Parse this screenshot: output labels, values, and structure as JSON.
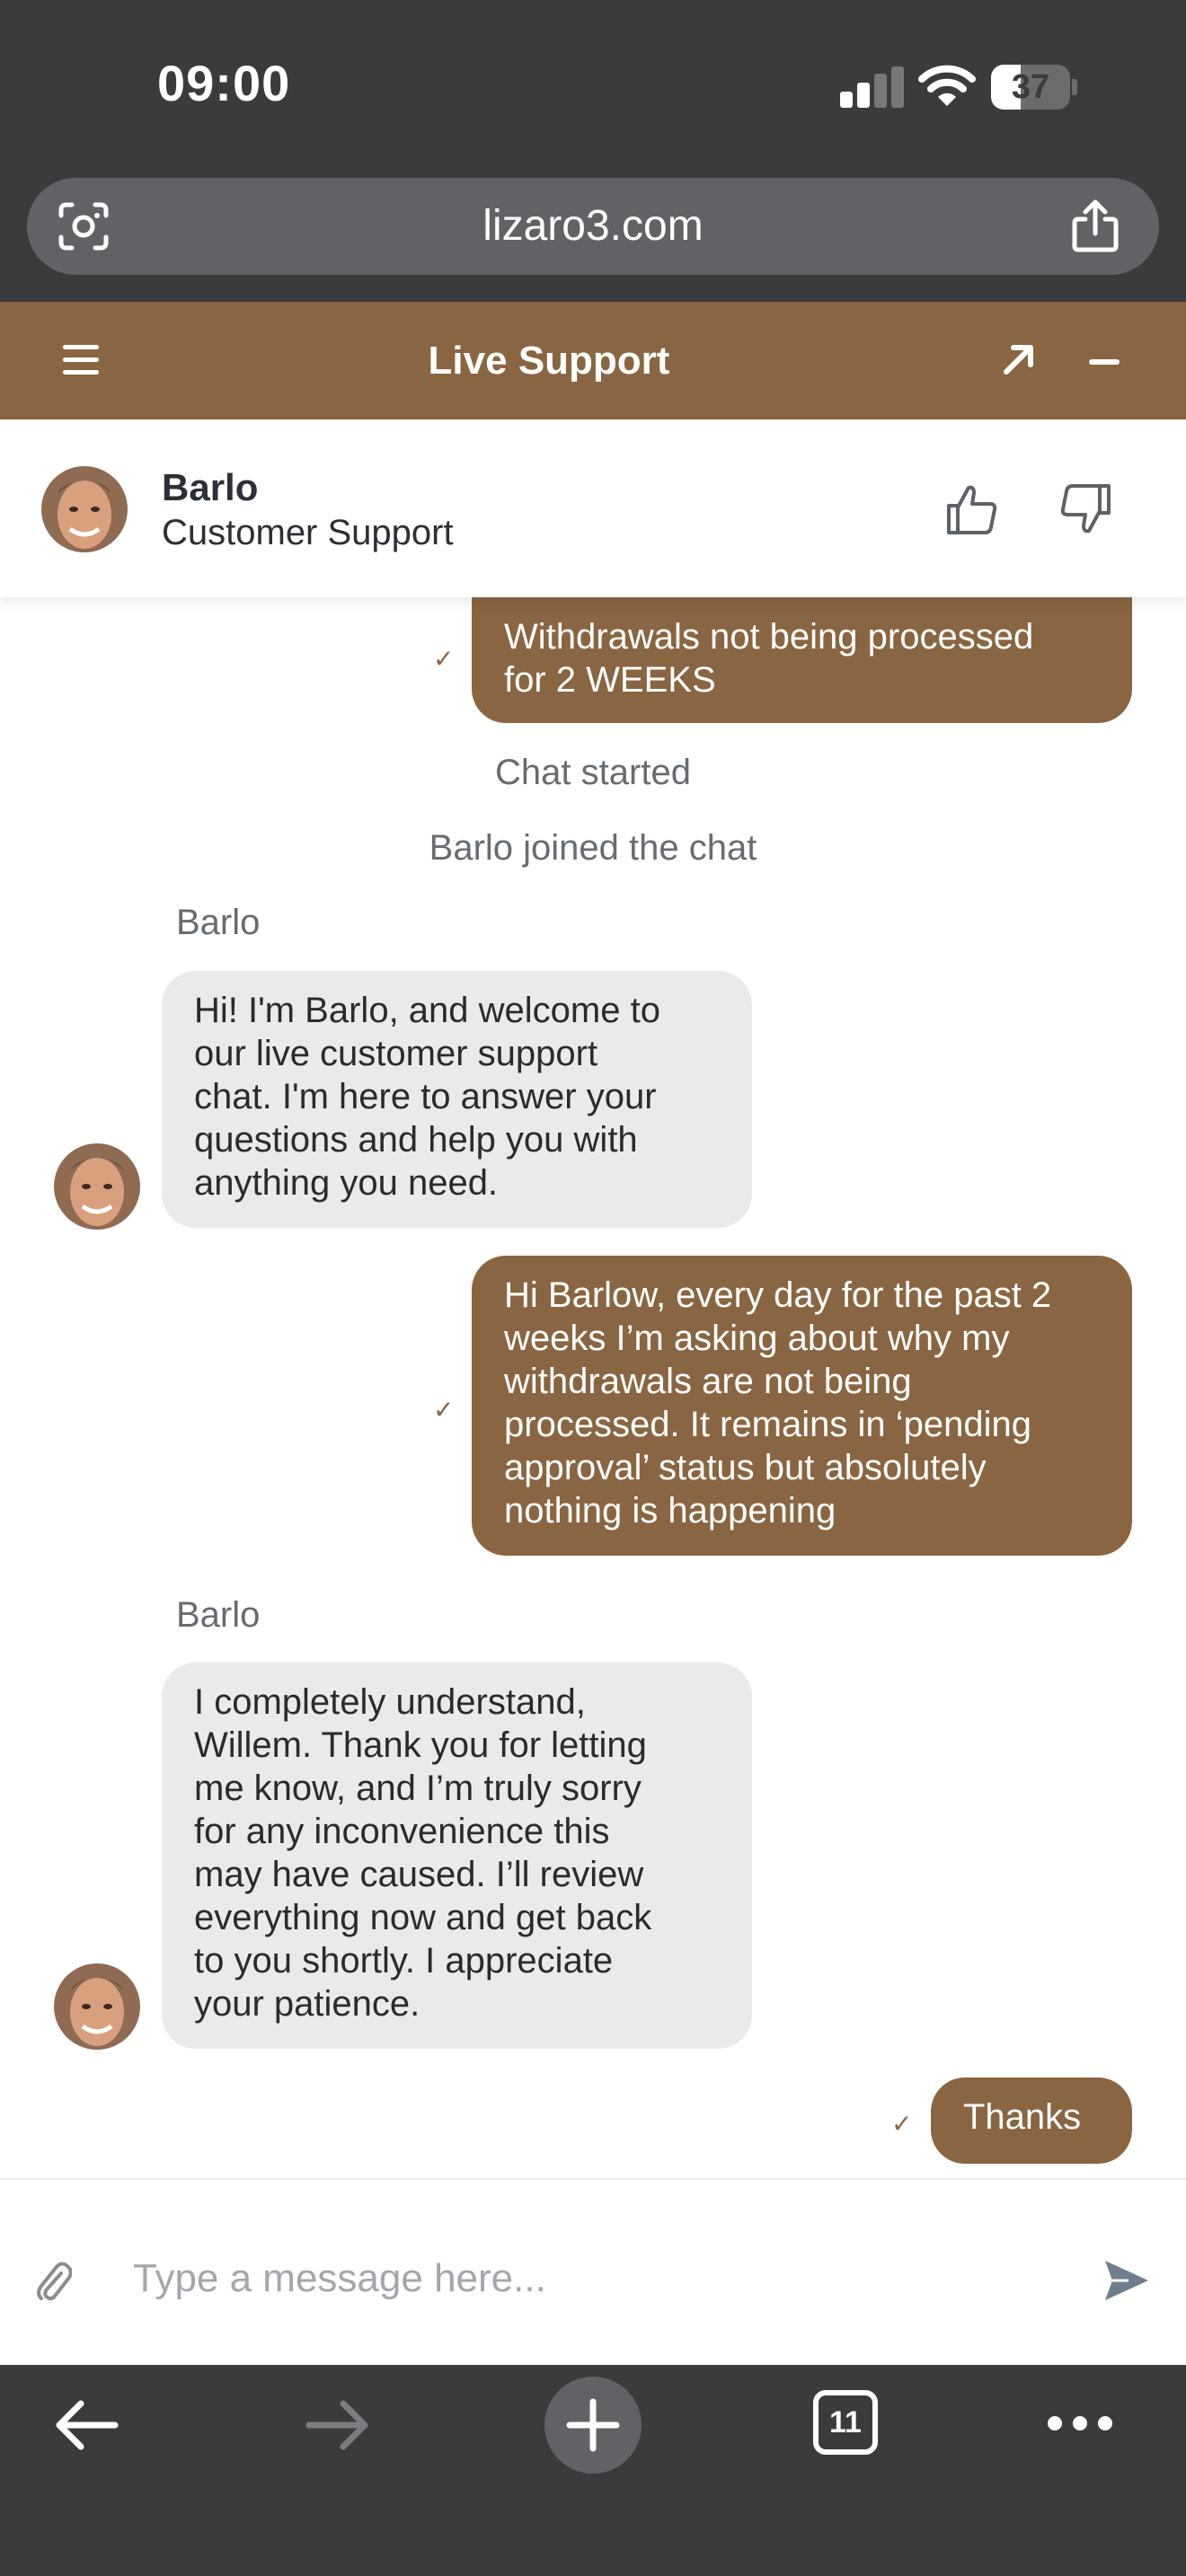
{
  "status_bar": {
    "time": "09:00",
    "battery": "37",
    "battery_level": 0.37,
    "icons": [
      "cellular-signal-icon",
      "wifi-icon",
      "battery-icon"
    ]
  },
  "browser": {
    "url": "lizaro3.com",
    "left_icon": "page-scan-icon",
    "right_icon": "share-icon",
    "tab_count": "11",
    "toolbar_icons": [
      "back-arrow-icon",
      "forward-arrow-icon",
      "new-tab-plus-icon",
      "tabs-icon",
      "more-icon"
    ]
  },
  "chat_header": {
    "title": "Live Support",
    "icons": [
      "menu-icon",
      "expand-icon",
      "minimize-icon"
    ],
    "background_color": "#8a6542"
  },
  "agent": {
    "name": "Barlo",
    "role": "Customer Support",
    "rate_icons": [
      "thumbs-up-icon",
      "thumbs-down-icon"
    ]
  },
  "messages": [
    {
      "type": "user",
      "text": "Withdrawals not being processed\nfor 2 WEEKS",
      "status": "sent"
    },
    {
      "type": "system",
      "text": "Chat started"
    },
    {
      "type": "system",
      "text": "Barlo joined the chat"
    },
    {
      "type": "agent",
      "sender": "Barlo",
      "text": "Hi! I'm Barlo, and welcome to\nour live customer support\nchat. I'm here to answer your\nquestions and help you with\nanything you need."
    },
    {
      "type": "user",
      "text": "Hi Barlow, every day for the past 2\nweeks I’m asking about why my\nwithdrawals are not being\nprocessed. It remains in ‘pending\napproval’ status but absolutely\nnothing is happening",
      "status": "sent"
    },
    {
      "type": "agent",
      "sender": "Barlo",
      "text": "I completely understand,\nWillem. Thank you for letting\nme know, and I’m truly sorry\nfor any inconvenience this\nmay have caused. I’ll review\neverything now and get back\nto you shortly. I appreciate\nyour patience."
    },
    {
      "type": "user",
      "text": "Thanks",
      "status": "sent"
    }
  ],
  "composer": {
    "placeholder": "Type a message here...",
    "value": "",
    "icons": [
      "attachment-icon",
      "send-icon"
    ]
  },
  "colors": {
    "accent": "#8a6542",
    "agent_bubble": "#e9eaec",
    "browser_chrome": "#3a3b3d"
  }
}
